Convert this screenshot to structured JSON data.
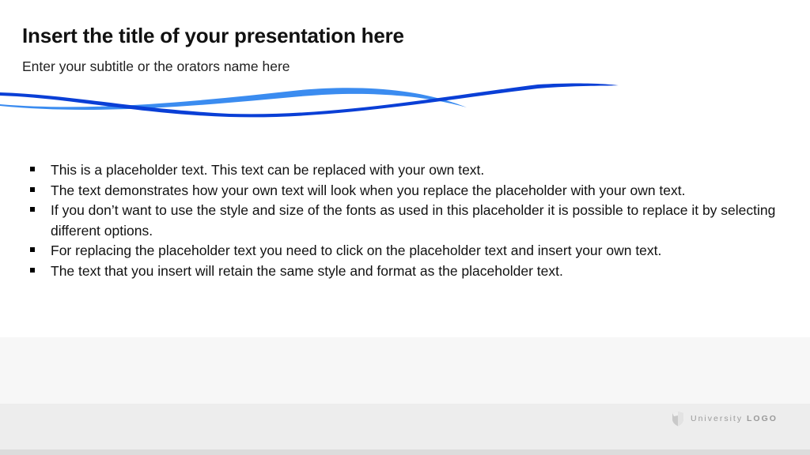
{
  "slide": {
    "title": "Insert the title of your presentation here",
    "subtitle": "Enter your subtitle or the orators name here",
    "bullets": [
      "This is a placeholder text. This text can be replaced with your own text.",
      "The text demonstrates how your own text will look when you replace the placeholder with your own text.",
      "If you don’t want to use the style and size of the fonts as used in this placeholder it is possible to replace it by selecting different options.",
      "For replacing the placeholder text you need to click on the placeholder text and insert your own text.",
      "The text that you insert will retain the same style and format as the placeholder text."
    ]
  },
  "footer": {
    "logo_text_regular": "University",
    "logo_text_bold": "LOGO",
    "logo_icon": "shield-icon"
  },
  "colors": {
    "wave_dark": "#0a3fd6",
    "wave_light": "#3b8cf0",
    "footer_band_light": "#f7f7f7",
    "footer_band_mid": "#ededed",
    "logo_text": "#9a9a9a"
  }
}
